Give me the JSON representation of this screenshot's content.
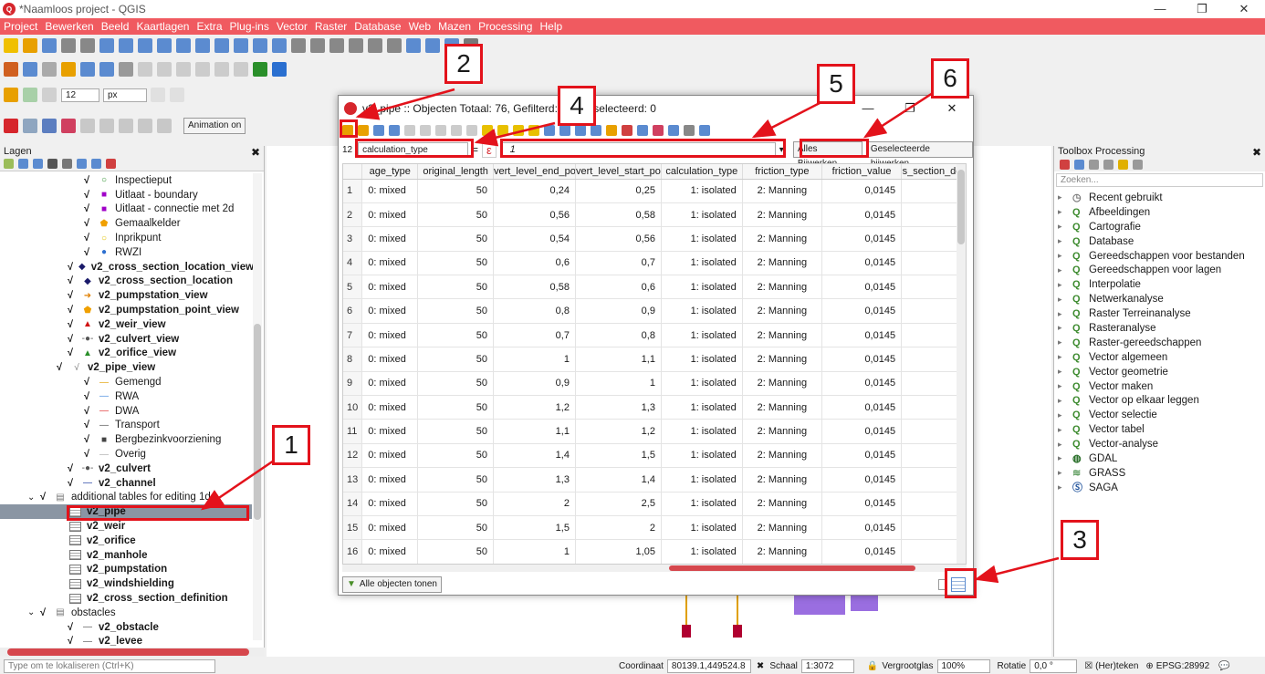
{
  "window": {
    "title": "*Naamloos project - QGIS",
    "min": "—",
    "max": "❐",
    "close": "✕"
  },
  "menu": [
    "Project",
    "Bewerken",
    "Beeld",
    "Kaartlagen",
    "Extra",
    "Plug-ins",
    "Vector",
    "Raster",
    "Database",
    "Web",
    "Mazen",
    "Processing",
    "Help"
  ],
  "toolbar": {
    "font_size": "12",
    "unit": "px",
    "animation": "Animation on"
  },
  "layers_panel": {
    "title": "Lagen",
    "items": [
      {
        "label": "Inspectieput",
        "sym": "○",
        "color": "#2a8f2a",
        "indent": 92,
        "bold": false
      },
      {
        "label": "Uitlaat - boundary",
        "sym": "■",
        "color": "#a000c8",
        "indent": 92,
        "bold": false
      },
      {
        "label": "Uitlaat - connectie met 2d",
        "sym": "■",
        "color": "#a000c8",
        "indent": 92,
        "bold": false
      },
      {
        "label": "Gemaalkelder",
        "sym": "⬟",
        "color": "#f0a000",
        "indent": 92,
        "bold": false
      },
      {
        "label": "Inprikpunt",
        "sym": "○",
        "color": "#e0c000",
        "indent": 92,
        "bold": false
      },
      {
        "label": "RWZI",
        "sym": "●",
        "color": "#2d6fd0",
        "indent": 92,
        "bold": false
      },
      {
        "label": "v2_cross_section_location_view",
        "sym": "◆",
        "color": "#1a1a6a",
        "indent": 74,
        "bold": true
      },
      {
        "label": "v2_cross_section_location",
        "sym": "◆",
        "color": "#1a1a6a",
        "indent": 74,
        "bold": true
      },
      {
        "label": "v2_pumpstation_view",
        "sym": "➜",
        "color": "#e08000",
        "indent": 74,
        "bold": true
      },
      {
        "label": "v2_pumpstation_point_view",
        "sym": "⬟",
        "color": "#f0a000",
        "indent": 74,
        "bold": true
      },
      {
        "label": "v2_weir_view",
        "sym": "▲",
        "color": "#d01010",
        "indent": 74,
        "bold": true
      },
      {
        "label": "v2_culvert_view",
        "sym": "-●-",
        "color": "#555555",
        "indent": 74,
        "bold": true
      },
      {
        "label": "v2_orifice_view",
        "sym": "▲",
        "color": "#2a8f2a",
        "indent": 74,
        "bold": true
      },
      {
        "label": "v2_pipe_view",
        "sym": "√",
        "color": "#777777",
        "indent": 62,
        "bold": true
      },
      {
        "label": "Gemengd",
        "sym": "—",
        "color": "#e0a000",
        "indent": 92,
        "bold": false
      },
      {
        "label": "RWA",
        "sym": "—",
        "color": "#4a8fe0",
        "indent": 92,
        "bold": false
      },
      {
        "label": "DWA",
        "sym": "—",
        "color": "#e03030",
        "indent": 92,
        "bold": false
      },
      {
        "label": "Transport",
        "sym": "—",
        "color": "#555555",
        "indent": 92,
        "bold": false
      },
      {
        "label": "Bergbezinkvoorziening",
        "sym": "■",
        "color": "#444444",
        "indent": 92,
        "bold": false
      },
      {
        "label": "Overig",
        "sym": "—",
        "color": "#aaaaaa",
        "indent": 92,
        "bold": false
      },
      {
        "label": "v2_culvert",
        "sym": "-●-",
        "color": "#555555",
        "indent": 74,
        "bold": true
      },
      {
        "label": "v2_channel",
        "sym": "—",
        "color": "#1a3aa0",
        "indent": 74,
        "bold": true
      },
      {
        "label": "additional tables for editing 1d",
        "sym": "",
        "color": "#333333",
        "indent": 44,
        "bold": false,
        "group": true
      },
      {
        "label": "v2_pipe",
        "sym": "",
        "color": "#333333",
        "indent": 76,
        "bold": true,
        "table": true,
        "selected": true
      },
      {
        "label": "v2_weir",
        "sym": "",
        "color": "#333333",
        "indent": 76,
        "bold": true,
        "table": true
      },
      {
        "label": "v2_orifice",
        "sym": "",
        "color": "#333333",
        "indent": 76,
        "bold": true,
        "table": true
      },
      {
        "label": "v2_manhole",
        "sym": "",
        "color": "#333333",
        "indent": 76,
        "bold": true,
        "table": true
      },
      {
        "label": "v2_pumpstation",
        "sym": "",
        "color": "#333333",
        "indent": 76,
        "bold": true,
        "table": true
      },
      {
        "label": "v2_windshielding",
        "sym": "",
        "color": "#333333",
        "indent": 76,
        "bold": true,
        "table": true
      },
      {
        "label": "v2_cross_section_definition",
        "sym": "",
        "color": "#333333",
        "indent": 76,
        "bold": true,
        "table": true
      },
      {
        "label": "obstacles",
        "sym": "",
        "color": "#333333",
        "indent": 44,
        "bold": false,
        "group": true
      },
      {
        "label": "v2_obstacle",
        "sym": "—",
        "color": "#555555",
        "indent": 74,
        "bold": true
      },
      {
        "label": "v2_levee",
        "sym": "—",
        "color": "#555555",
        "indent": 74,
        "bold": true
      }
    ]
  },
  "toolbox": {
    "title": "Toolbox Processing",
    "search_placeholder": "Zoeken...",
    "items": [
      "Recent gebruikt",
      "Afbeeldingen",
      "Cartografie",
      "Database",
      "Gereedschappen voor bestanden",
      "Gereedschappen voor lagen",
      "Interpolatie",
      "Netwerkanalyse",
      "Raster Terreinanalyse",
      "Rasteranalyse",
      "Raster-gereedschappen",
      "Vector algemeen",
      "Vector geometrie",
      "Vector maken",
      "Vector op elkaar leggen",
      "Vector selectie",
      "Vector tabel",
      "Vector-analyse",
      "GDAL",
      "GRASS",
      "SAGA"
    ]
  },
  "dialog": {
    "title": "v2_pipe :: Objecten Totaal: 76, Gefilterd: 76, Geselecteerd: 0",
    "field": "calculation_type",
    "equals": "=",
    "epsilon": "ε",
    "expression": "1",
    "update_all": "Alles Bijwerken",
    "update_selected": "Geselecteerde bijwerken",
    "filter_label": "Alle objecten tonen",
    "columns": [
      "age_type",
      "original_length",
      "vert_level_end_poi",
      "vert_level_start_poi",
      "calculation_type",
      "friction_type",
      "friction_value",
      "s_section_def"
    ],
    "rows": [
      [
        "1",
        "0: mixed",
        "50",
        "0,24",
        "0,25",
        "1: isolated",
        "2: Manning",
        "0,0145"
      ],
      [
        "2",
        "0: mixed",
        "50",
        "0,56",
        "0,58",
        "1: isolated",
        "2: Manning",
        "0,0145"
      ],
      [
        "3",
        "0: mixed",
        "50",
        "0,54",
        "0,56",
        "1: isolated",
        "2: Manning",
        "0,0145"
      ],
      [
        "4",
        "0: mixed",
        "50",
        "0,6",
        "0,7",
        "1: isolated",
        "2: Manning",
        "0,0145"
      ],
      [
        "5",
        "0: mixed",
        "50",
        "0,58",
        "0,6",
        "1: isolated",
        "2: Manning",
        "0,0145"
      ],
      [
        "6",
        "0: mixed",
        "50",
        "0,8",
        "0,9",
        "1: isolated",
        "2: Manning",
        "0,0145"
      ],
      [
        "7",
        "0: mixed",
        "50",
        "0,7",
        "0,8",
        "1: isolated",
        "2: Manning",
        "0,0145"
      ],
      [
        "8",
        "0: mixed",
        "50",
        "1",
        "1,1",
        "1: isolated",
        "2: Manning",
        "0,0145"
      ],
      [
        "9",
        "0: mixed",
        "50",
        "0,9",
        "1",
        "1: isolated",
        "2: Manning",
        "0,0145"
      ],
      [
        "10",
        "0: mixed",
        "50",
        "1,2",
        "1,3",
        "1: isolated",
        "2: Manning",
        "0,0145"
      ],
      [
        "11",
        "0: mixed",
        "50",
        "1,1",
        "1,2",
        "1: isolated",
        "2: Manning",
        "0,0145"
      ],
      [
        "12",
        "0: mixed",
        "50",
        "1,4",
        "1,5",
        "1: isolated",
        "2: Manning",
        "0,0145"
      ],
      [
        "13",
        "0: mixed",
        "50",
        "1,3",
        "1,4",
        "1: isolated",
        "2: Manning",
        "0,0145"
      ],
      [
        "14",
        "0: mixed",
        "50",
        "2",
        "2,5",
        "1: isolated",
        "2: Manning",
        "0,0145"
      ],
      [
        "15",
        "0: mixed",
        "50",
        "1,5",
        "2",
        "1: isolated",
        "2: Manning",
        "0,0145"
      ],
      [
        "16",
        "0: mixed",
        "50",
        "1",
        "1,05",
        "1: isolated",
        "2: Manning",
        "0,0145"
      ]
    ]
  },
  "callouts": [
    "1",
    "2",
    "3",
    "4",
    "5",
    "6"
  ],
  "status": {
    "locator_placeholder": "Type om te lokaliseren (Ctrl+K)",
    "coord_label": "Coordinaat",
    "coord": "80139.1,449524.8",
    "scale_label": "Schaal",
    "scale": "1:3072",
    "magnifier_label": "Vergrootglas",
    "magnifier": "100%",
    "rotation_label": "Rotatie",
    "rotation": "0,0 °",
    "render": "(Her)teken",
    "crs": "EPSG:28992"
  }
}
